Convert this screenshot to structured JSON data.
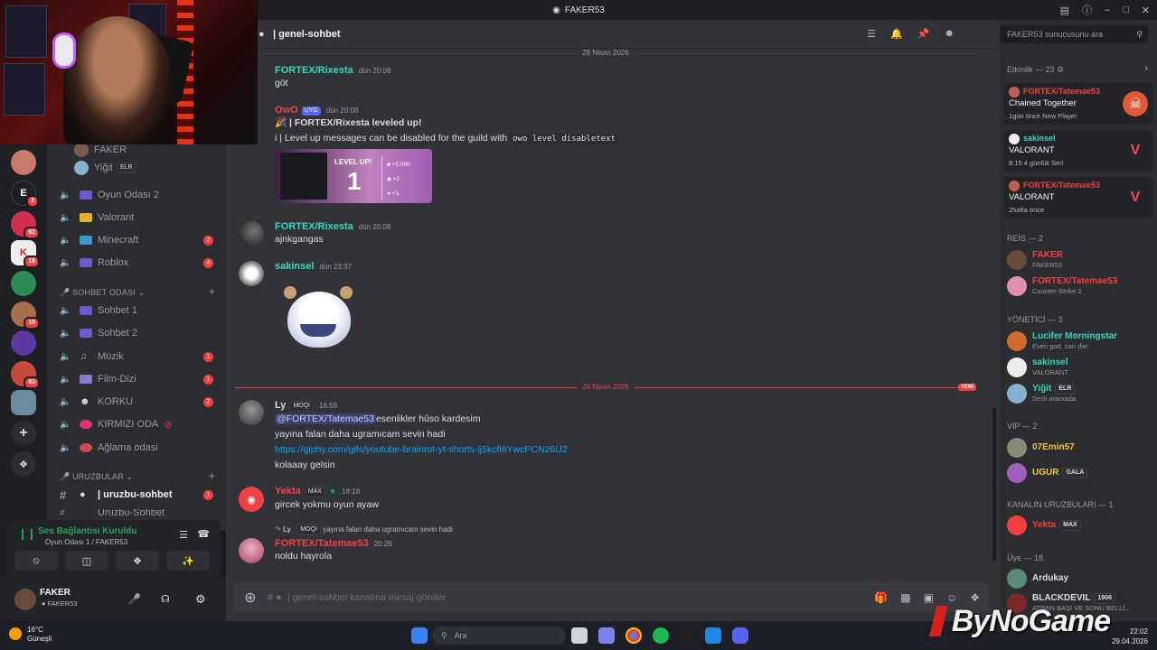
{
  "window": {
    "title": "FAKER53"
  },
  "rail": {
    "servers": [
      {
        "id": "s1",
        "badge": ""
      },
      {
        "id": "s2",
        "letter": "E",
        "badge": "2"
      },
      {
        "id": "s3",
        "badge": "62"
      },
      {
        "id": "s4",
        "badge": "18"
      },
      {
        "id": "s5",
        "badge": ""
      },
      {
        "id": "s6",
        "badge": "10"
      },
      {
        "id": "s7",
        "badge": ""
      },
      {
        "id": "s8",
        "badge": "83"
      },
      {
        "id": "s9",
        "badge": ""
      }
    ]
  },
  "channels": {
    "voice_users": [
      {
        "name": "FAKER"
      },
      {
        "name": "Yiğit",
        "tag": "ELR"
      }
    ],
    "voice_channels": [
      {
        "name": "Oyun Odası 2",
        "badge": ""
      },
      {
        "name": "Valorant",
        "badge": ""
      },
      {
        "name": "Minecraft",
        "badge": "2"
      },
      {
        "name": "Roblox",
        "badge": "4"
      }
    ],
    "category_sohbet": "SOHBET ODASI",
    "sohbet_channels": [
      {
        "name": "Sohbet 1",
        "badge": ""
      },
      {
        "name": "Sohbet 2",
        "badge": ""
      },
      {
        "name": "Müzik",
        "badge": "1"
      },
      {
        "name": "Film-Dizi",
        "badge": "1"
      },
      {
        "name": "KORKU",
        "badge": "2"
      },
      {
        "name": "KIRMIZI ODA",
        "badge": ""
      },
      {
        "name": "Ağlama odasi",
        "badge": ""
      }
    ],
    "category_uruz": "URUZBULAR",
    "uruz_channels": [
      {
        "name": "| uruzbu-sohbet",
        "badge": "1"
      },
      {
        "name": "Uruzbu-Sohbet",
        "badge": ""
      }
    ]
  },
  "voice_status": {
    "title": "Ses Bağlantısı Kuruldu",
    "subtitle": "Oyun Odası 1 / FAKER53"
  },
  "user_panel": {
    "name": "FAKER",
    "status": "FAKER53"
  },
  "chat": {
    "channel": "| genel-sohbet",
    "date1": "28 Nisan 2026",
    "date2": "29 Nisan 2026",
    "new_label": "YENİ",
    "messages": [
      {
        "author": "FORTEX/Rixesta",
        "time": "dün 20:08",
        "lines": [
          "göt"
        ],
        "color": "#3ad6c0"
      },
      {
        "author": "OwO",
        "tag": "UYG",
        "time": "dün 20:08",
        "lines": [
          "| FORTEX/Rixesta leveled up!",
          "| Level up messages can be disabled for the guild with"
        ],
        "code": "owo level disabletext",
        "color": "#f23f43"
      },
      {
        "author": "FORTEX/Rixesta",
        "time": "dün 20:08",
        "lines": [
          "ajnkgangas"
        ],
        "color": "#3ad6c0"
      },
      {
        "author": "sakinsel",
        "time": "dün 23:37",
        "lines": [],
        "color": "#3ad6c0"
      },
      {
        "author": "Ly",
        "tag": "MOQI",
        "time": "16:59",
        "mention": "@FORTEX/Tatemae53",
        "lines": [
          "esenlikler hûso kardesim",
          "yayına falan daha ugramıcam sevin hadi"
        ],
        "link": "https://giphy.com/gifs/youtube-brainrot-yt-shorts-lj5kcfl6YwcPCN26U2",
        "last": "kolaaay gelsin",
        "color": "#dbdee1"
      },
      {
        "author": "Yekta",
        "tag": "MAX",
        "time": "18:18",
        "lines": [
          "gircek yokmu oyun ayaw"
        ],
        "color": "#f23f43"
      },
      {
        "reply_author": "Ly",
        "reply_tag": "MOQI",
        "reply_text": "yayına falan daha ugramıcam sevin hadi",
        "author": "FORTEX/Tatemae53",
        "time": "20:26",
        "lines": [
          "noldu hayrola"
        ],
        "color": "#f23f43"
      }
    ],
    "levelup": {
      "label": "LEVEL UP!",
      "level": "1",
      "r1": "+5.000",
      "r2": "+1",
      "r3": "+1"
    },
    "composer_placeholder": "| genel-sohbet kanalına mesaj gönder"
  },
  "sidebar": {
    "search_placeholder": "FAKER53 sunucusunu ara",
    "activity_header": "Etkinlik — 23",
    "activities": [
      {
        "user": "FORTEX/Tatemae53",
        "game": "Chained Together",
        "meta": "1gün önce   New Player"
      },
      {
        "user": "sakinsel",
        "game": "VALORANT",
        "meta": "8:15   4 günlük Seri"
      },
      {
        "user": "FORTEX/Tatemae53",
        "game": "VALORANT",
        "meta": "2hafta önce"
      }
    ],
    "groups": [
      {
        "header": "REİS — 2",
        "members": [
          {
            "name": "FAKER",
            "sub": "FAKER53",
            "color": "#f23f43"
          },
          {
            "name": "FORTEX/Tatemae53",
            "sub": "Counter-Strike 2",
            "color": "#f23f43"
          }
        ]
      },
      {
        "header": "YÖNETİCİ — 3",
        "members": [
          {
            "name": "Lucifer Morningstar",
            "sub": "Even god, can die!",
            "color": "#3ad6c0"
          },
          {
            "name": "sakinsel",
            "sub": "VALORANT",
            "color": "#3ad6c0"
          },
          {
            "name": "Yiğit",
            "tag": "ELR",
            "sub": "Sesli aramada",
            "color": "#3ad6c0"
          }
        ]
      },
      {
        "header": "VIP — 2",
        "members": [
          {
            "name": "07Emin57",
            "sub": "",
            "color": "#f0c43a"
          },
          {
            "name": "UGUR",
            "tag": "GALA",
            "sub": "",
            "color": "#f0c43a"
          }
        ]
      },
      {
        "header": "KANALIN URUZBULARI — 1",
        "members": [
          {
            "name": "Yekta",
            "tag": "MAX",
            "sub": "",
            "color": "#f23f43"
          }
        ]
      },
      {
        "header": "Üye — 18",
        "members": [
          {
            "name": "Ardukay",
            "sub": "",
            "color": "#dbdee1"
          },
          {
            "name": "BLACKDEVIL",
            "tag": "1906",
            "sub": "ATIMIN BAŞI VE SONU BELLİ...",
            "color": "#dbdee1"
          }
        ]
      }
    ]
  },
  "taskbar": {
    "temp": "16°C",
    "weather": "Güneşli",
    "search": "Ara",
    "time": "22:02",
    "date": "29.04.2026"
  },
  "watermark": "ByNoGame",
  "colors": {
    "accent": "#5865f2",
    "danger": "#f23f43",
    "bg_main": "#313338",
    "bg_side": "#2b2d31"
  }
}
